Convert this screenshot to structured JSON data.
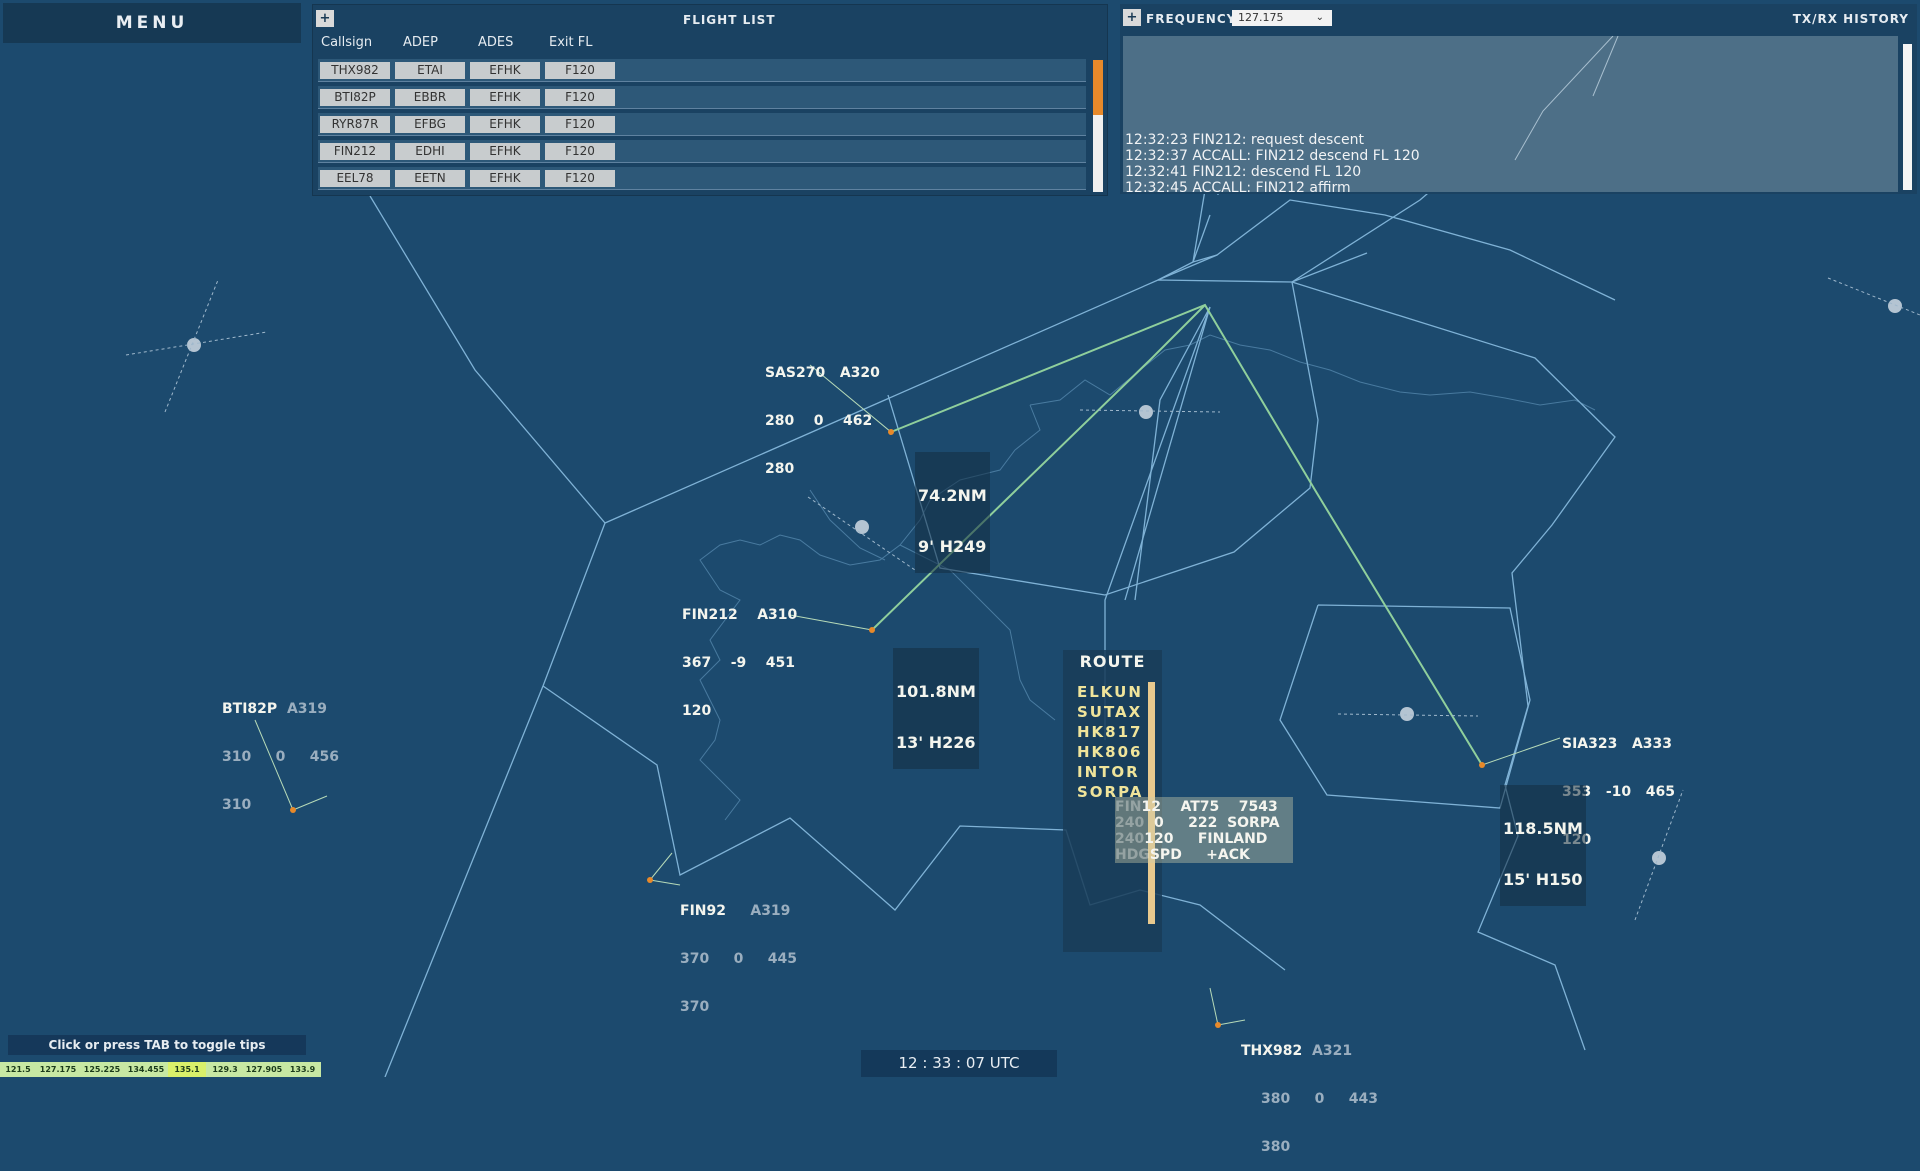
{
  "menu": {
    "label": "MENU"
  },
  "flight_list": {
    "title": "FLIGHT LIST",
    "plus": "+",
    "columns": [
      "Callsign",
      "ADEP",
      "ADES",
      "Exit FL"
    ],
    "rows": [
      {
        "callsign": "THX982",
        "adep": "ETAI",
        "ades": "EFHK",
        "exit_fl": "F120"
      },
      {
        "callsign": "BTI82P",
        "adep": "EBBR",
        "ades": "EFHK",
        "exit_fl": "F120"
      },
      {
        "callsign": "RYR87R",
        "adep": "EFBG",
        "ades": "EFHK",
        "exit_fl": "F120"
      },
      {
        "callsign": "FIN212",
        "adep": "EDHI",
        "ades": "EFHK",
        "exit_fl": "F120"
      },
      {
        "callsign": "EEL78",
        "adep": "EETN",
        "ades": "EFHK",
        "exit_fl": "F120"
      }
    ]
  },
  "frequency_panel": {
    "plus": "+",
    "label": "FREQUENCY:",
    "selected": "127.175",
    "history_title": "TX/RX HISTORY",
    "history": [
      "12:32:23 FIN212:  request descent",
      "12:32:37 ACCALL: FIN212 descend FL 120",
      "12:32:41 FIN212:  descend FL 120",
      "12:32:45 ACCALL: FIN212 affirm"
    ]
  },
  "aircraft": {
    "sas270": {
      "l1": "SAS270   A320",
      "l2": "280    0    462",
      "l3": "280"
    },
    "fin212": {
      "l1": "FIN212    A310",
      "l2": "367    -9    451",
      "l3": "120"
    },
    "bti82p": {
      "l1a": "BTI82P",
      "l1b": "A319",
      "l2": "310     0     456",
      "l3": "310"
    },
    "sia323": {
      "l1": "SIA323   A333",
      "l2": "353   -10   465",
      "l3": "120"
    },
    "fin92": {
      "l1a": "FIN92",
      "l1b": "A319",
      "l2": "370     0     445",
      "l3": "370"
    },
    "thx982": {
      "l1a": "THX982",
      "l1b": "A321",
      "l2": "380     0     443",
      "l3": "380"
    }
  },
  "distances": [
    {
      "line1": "74.2NM",
      "line2": "9' H249"
    },
    {
      "line1": "101.8NM",
      "line2": "13' H226"
    },
    {
      "line1": "118.5NM",
      "line2": "15' H150"
    }
  ],
  "route": {
    "title": "ROUTE",
    "fixes": [
      "ELKUN",
      "SUTAX",
      "HK817",
      "HK806",
      "INTOR",
      "SORPA"
    ]
  },
  "datablock": {
    "l1a": "FIN",
    "l1b": "12    AT75    7543",
    "l2a": "240",
    "l2b": "0     222  SORPA",
    "l3a": "240",
    "l3b": "120     FINLAND",
    "l4a": "HDG",
    "l4b": "SPD     +ACK"
  },
  "tips": {
    "label": "Click or press TAB to toggle tips"
  },
  "freq_strip": [
    "121.5",
    "127.175",
    "125.225",
    "134.455",
    "135.1",
    "129.3",
    "127.905",
    "133.9"
  ],
  "clock": {
    "label": "12 : 33 : 07 UTC"
  },
  "colors": {
    "background": "#1c4a6e",
    "sector_line": "#7fb2d6",
    "route_line": "#8fcf9c",
    "aircraft": "#e7892a"
  }
}
